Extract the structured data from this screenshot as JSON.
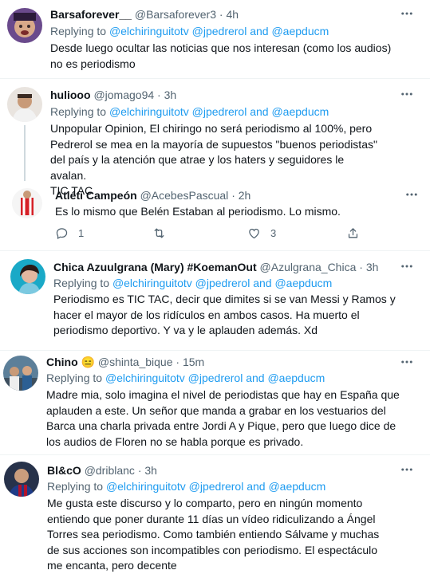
{
  "tweets": [
    {
      "name": "Barsaforever__",
      "handle": "@Barsaforever3",
      "time": "4h",
      "replying_prefix": "Replying to",
      "mentions": [
        "@elchiringuitotv",
        "@jpedrerol",
        "@aepducm"
      ],
      "and": "and",
      "text": "Desde luego ocultar las noticias que nos interesan (como los audios) no es periodismo"
    },
    {
      "name": "huliooo",
      "handle": "@jomago94",
      "time": "3h",
      "replying_prefix": "Replying to",
      "mentions": [
        "@elchiringuitotv",
        "@jpedrerol",
        "@aepducm"
      ],
      "and": "and",
      "text": "Unpopular Opinion, El chiringo no será periodismo al 100%, pero Pedrerol se mea en la mayoría de supuestos \"buenos periodistas\" del país y la atención que atrae y los haters y seguidores le avalan.\nTIC TAC"
    },
    {
      "name": "Atléti Campeón",
      "handle": "@AcebesPascual",
      "time": "2h",
      "text": "Es lo mismo que Belén Estaban al periodismo. Lo mismo.",
      "reply_count": "1",
      "like_count": "3"
    },
    {
      "name": "Chica Azuulgrana (Mary) #KoemanOut",
      "handle": "@Azulgrana_Chica",
      "time": "3h",
      "replying_prefix": "Replying to",
      "mentions": [
        "@elchiringuitotv",
        "@jpedrerol",
        "@aepducm"
      ],
      "and": "and",
      "text": "Periodismo es TIC TAC, decir que dimites si se van Messi y Ramos y hacer el mayor de los ridículos en ambos casos. Ha muerto el periodismo deportivo. Y va y le aplauden además. Xd"
    },
    {
      "name": "Chino",
      "emoji": "😑",
      "handle": "@shinta_bique",
      "time": "15m",
      "replying_prefix": "Replying to",
      "mentions": [
        "@elchiringuitotv",
        "@jpedrerol",
        "@aepducm"
      ],
      "and": "and",
      "text": "Madre mia, solo imagina el nivel de periodistas que hay en España que aplauden a este. Un señor que manda a grabar en los vestuarios del Barca una charla privada entre Jordi A y Pique, pero que luego dice de los audios de Floren no se habla porque es privado."
    },
    {
      "name": "Bl&cO",
      "handle": "@driblanc",
      "time": "3h",
      "replying_prefix": "Replying to",
      "mentions": [
        "@elchiringuitotv",
        "@jpedrerol",
        "@aepducm"
      ],
      "and": "and",
      "text": "Me gusta este discurso y lo comparto, pero en ningún momento entiendo que poner durante 11 días un vídeo ridiculizando a Ángel Torres sea periodismo. Como también entiendo Sálvame y muchas de sus acciones son incompatibles con periodismo. El espectáculo me encanta, pero decente"
    }
  ],
  "separator_dot": "·",
  "colors": {
    "mention": "#1d9bf0",
    "secondary": "#536471",
    "text": "#0f1419",
    "divider": "#eff3f4"
  },
  "icons": {
    "more": "more-icon",
    "reply": "reply-icon",
    "retweet": "retweet-icon",
    "like": "like-icon",
    "share": "share-icon"
  }
}
